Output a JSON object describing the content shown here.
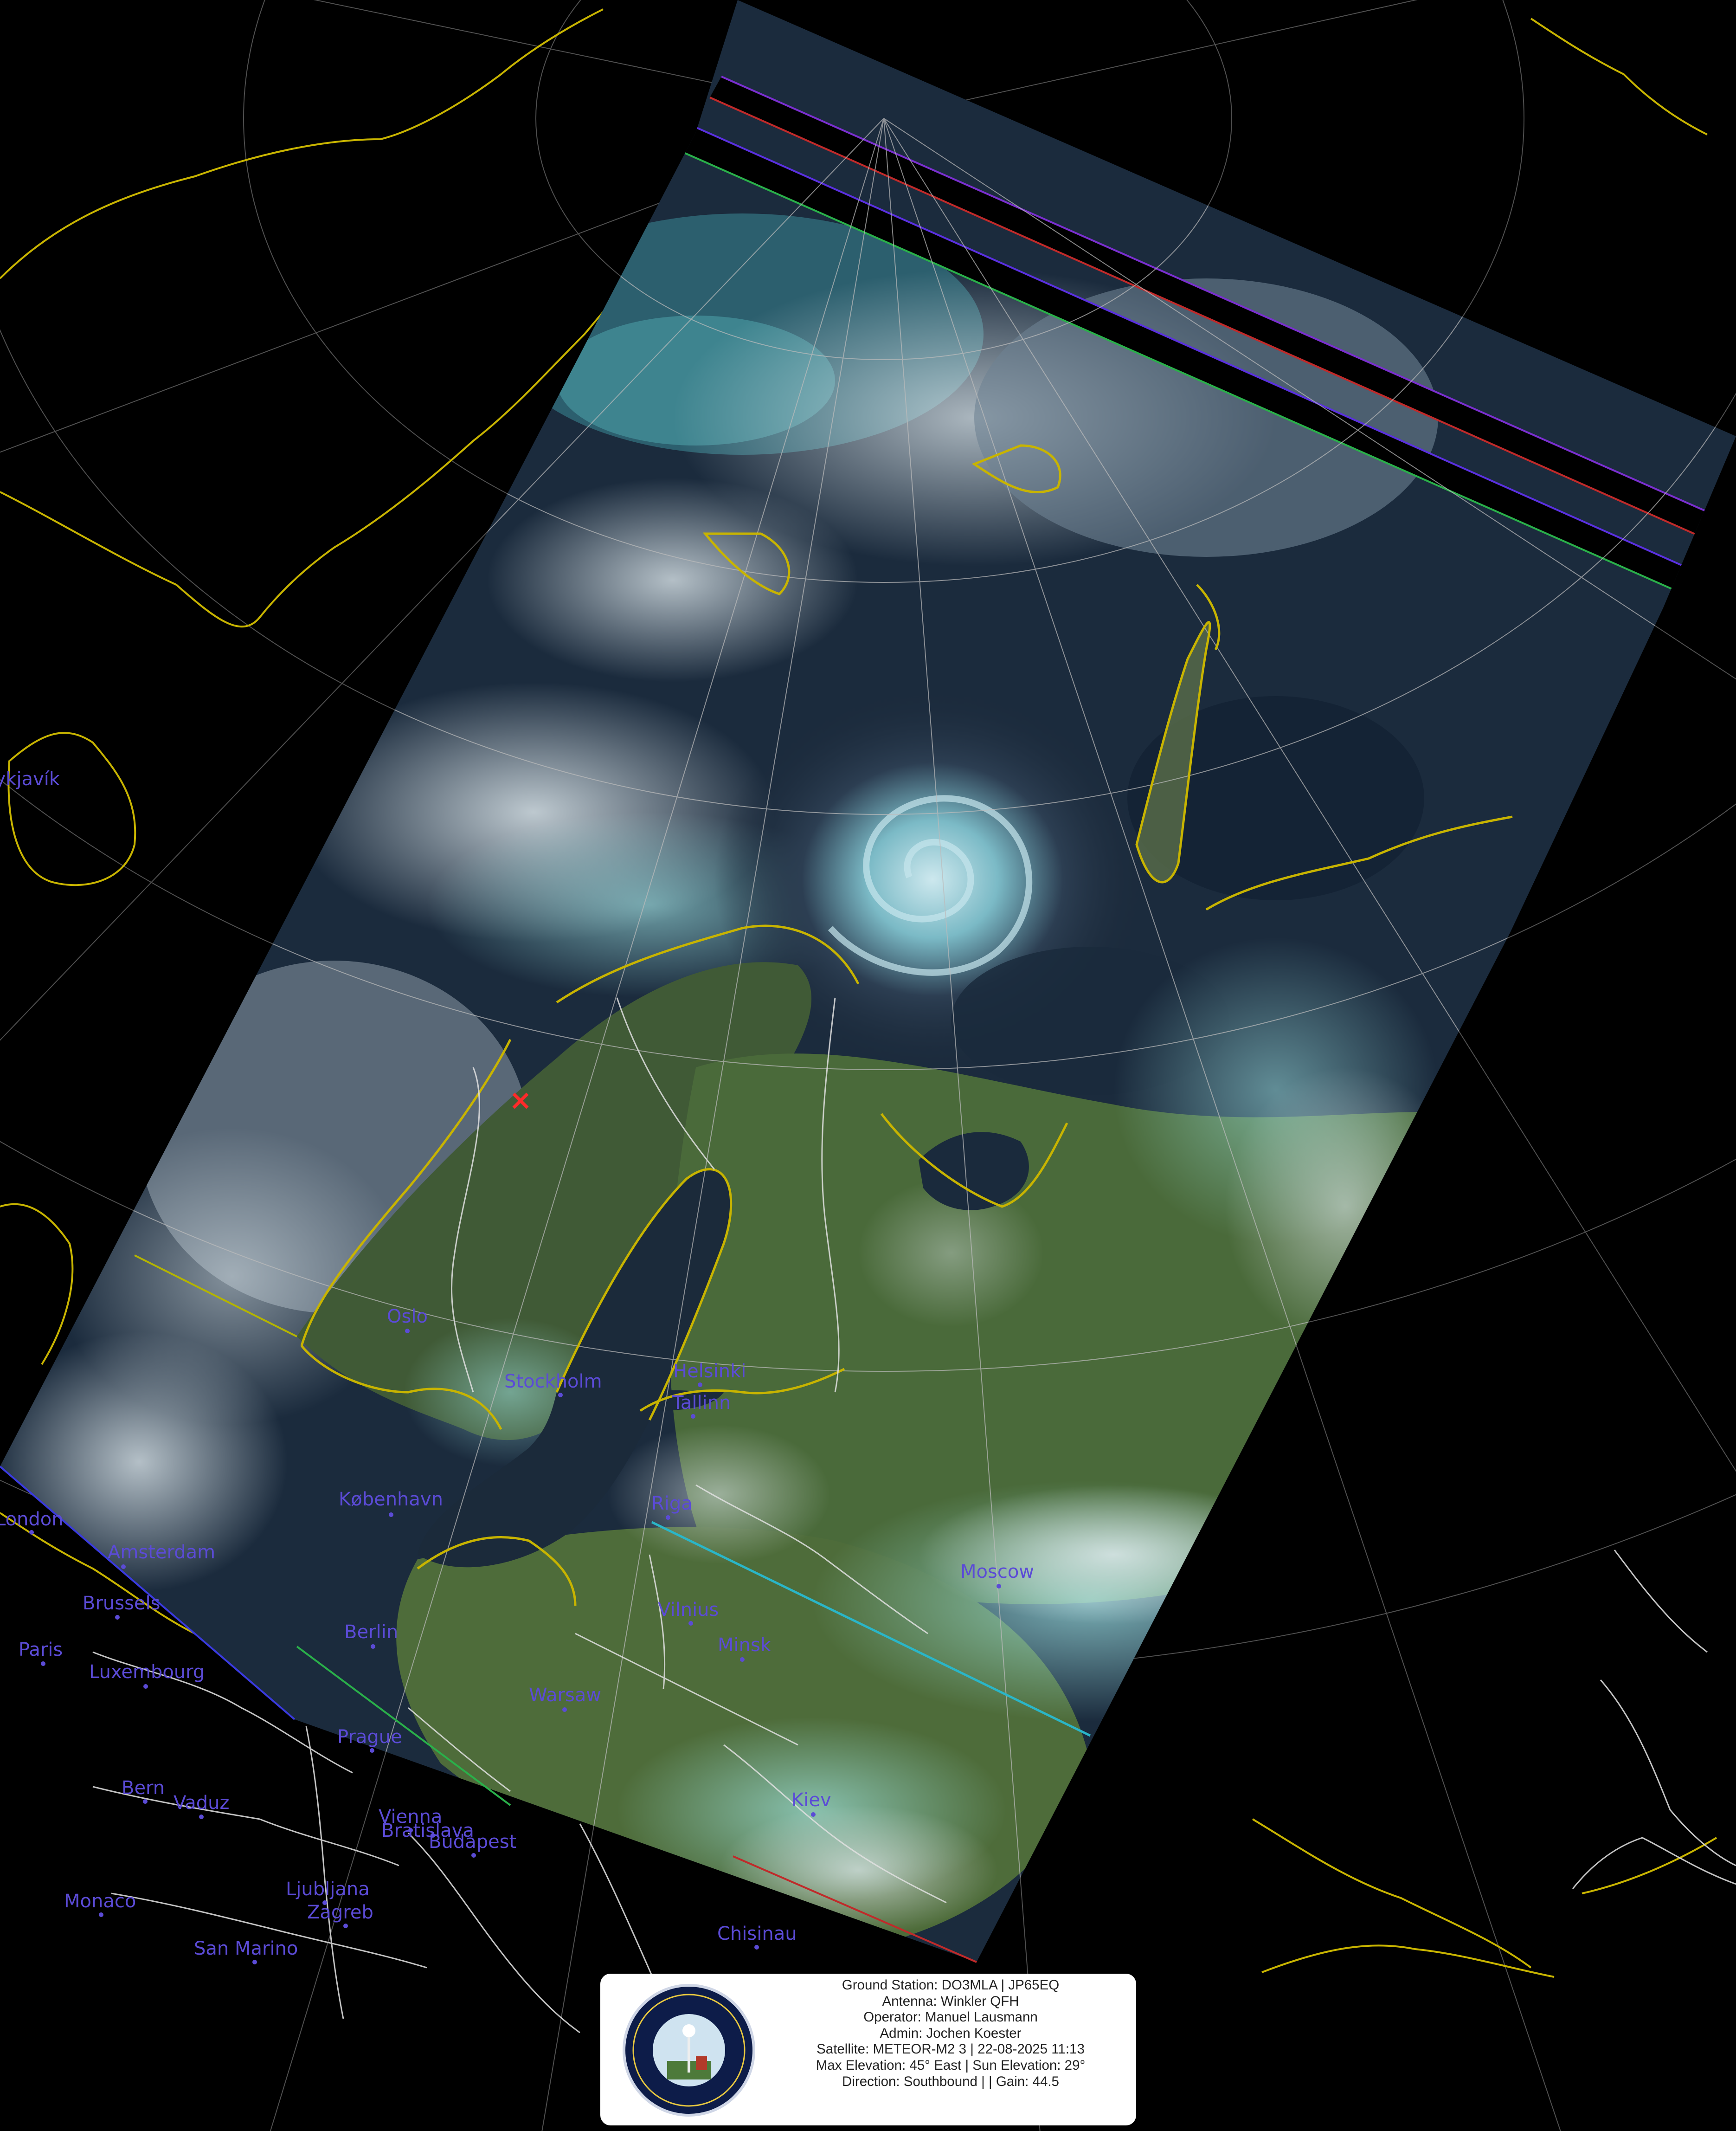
{
  "map": {
    "cities": [
      {
        "name": "London",
        "key": "london"
      },
      {
        "name": "Amsterdam",
        "key": "amsterdam"
      },
      {
        "name": "Brussels",
        "key": "brussels"
      },
      {
        "name": "Paris",
        "key": "paris"
      },
      {
        "name": "Luxembourg",
        "key": "luxembourg"
      },
      {
        "name": "Oslo",
        "key": "oslo"
      },
      {
        "name": "Stockholm",
        "key": "stockholm"
      },
      {
        "name": "Helsinki",
        "key": "helsinki"
      },
      {
        "name": "Tallinn",
        "key": "tallinn"
      },
      {
        "name": "København",
        "key": "kobenhavn"
      },
      {
        "name": "Riga",
        "key": "riga"
      },
      {
        "name": "Moscow",
        "key": "moscow"
      },
      {
        "name": "Berlin",
        "key": "berlin"
      },
      {
        "name": "Vilnius",
        "key": "vilnius"
      },
      {
        "name": "Minsk",
        "key": "minsk"
      },
      {
        "name": "Warsaw",
        "key": "warsaw"
      },
      {
        "name": "Prague",
        "key": "prague"
      },
      {
        "name": "Bern",
        "key": "bern"
      },
      {
        "name": "Vaduz",
        "key": "vaduz"
      },
      {
        "name": "Vienna",
        "key": "vienna"
      },
      {
        "name": "Bratislava",
        "key": "bratislava"
      },
      {
        "name": "Budapest",
        "key": "budapest"
      },
      {
        "name": "Kiev",
        "key": "kiev"
      },
      {
        "name": "Monaco",
        "key": "monaco"
      },
      {
        "name": "Ljubljana",
        "key": "ljubljana"
      },
      {
        "name": "Zagreb",
        "key": "zagreb"
      },
      {
        "name": "San Marino",
        "key": "san_marino"
      },
      {
        "name": "Chisinau",
        "key": "chisinau"
      },
      {
        "name": "Reykjavík",
        "key": "reykjavik"
      }
    ],
    "colors": {
      "background": "#000000",
      "coastline": "#c8b400",
      "borders": "#d8d8d8",
      "graticule": "#9a9a9a",
      "city_label": "#5b4bd6",
      "station_marker": "#ff2a2a",
      "ocean_dark": "#1a2a40",
      "cloud": "#d8e4ec",
      "cloud_cyan": "#9de8ec",
      "land_green": "#4c6a3a"
    },
    "station_marker_icon": "x-marker-icon"
  },
  "info_panel": {
    "logo_icon": "ground-station-logo-icon",
    "lines": {
      "ground_station": "Ground Station: DO3MLA | JP65EQ",
      "antenna": "Antenna: Winkler QFH",
      "operator": "Operator: Manuel Lausmann",
      "admin": "Admin: Jochen Koester",
      "satellite": "Satellite: METEOR-M2 3 | 22-08-2025 11:13",
      "elevation": "Max Elevation: 45° East | Sun Elevation: 29°",
      "direction": "Direction: Southbound | | Gain: 44.5"
    }
  }
}
